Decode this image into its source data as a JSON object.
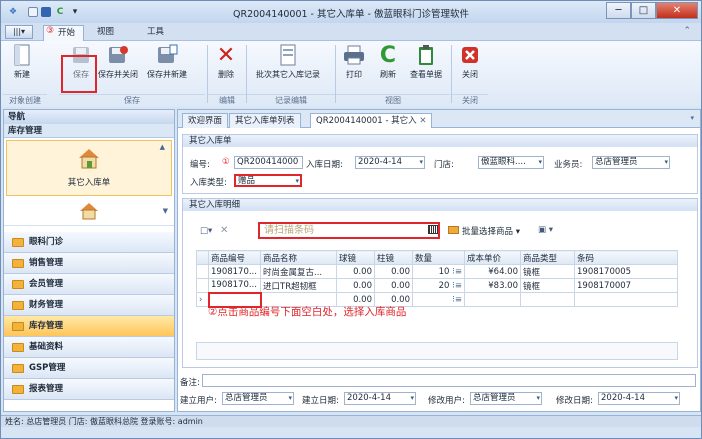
{
  "window": {
    "title": "QR2004140001 - 其它入库单 - 傲蓝眼科门诊管理软件",
    "min": "─",
    "max": "□",
    "close": "✕"
  },
  "quick_access": {
    "dropdown": "▾"
  },
  "ribbon_tabs": {
    "file": "|||▾",
    "start": "开始",
    "view": "视图",
    "tools": "工具",
    "collapse": "⌃"
  },
  "annotations": {
    "n1": "①",
    "n3": "③",
    "hint": "②点击商品编号下面空白处，选择入库商品"
  },
  "toolbar": {
    "new": "新建",
    "save": "保存",
    "save_close": "保存并关闭",
    "save_new": "保存并新建",
    "delete": "删除",
    "batch": "批次其它入库记录",
    "print": "打印",
    "refresh": "刷新",
    "view_doc": "查看单据",
    "close": "关闭"
  },
  "groups": {
    "create": "对象创建",
    "save": "保存",
    "edit": "编辑",
    "record_edit": "记录编辑",
    "view": "视图",
    "close": "关闭"
  },
  "nav": {
    "title": "导航",
    "sub": "库存管理",
    "big_item": "其它入库单",
    "items": [
      "眼科门诊",
      "销售管理",
      "会员管理",
      "财务管理",
      "库存管理",
      "基础资料",
      "GSP管理",
      "报表管理"
    ]
  },
  "doc_tabs": [
    "欢迎界面",
    "其它入库单列表",
    "QR2004140001 - 其它入"
  ],
  "doc_tab_close": "✕",
  "form": {
    "section": "其它入库单",
    "code_label": "编号:",
    "code_value": "QR200414000",
    "date_label": "入库日期:",
    "date_value": "2020-4-14",
    "store_label": "门店:",
    "store_value": "傲蓝眼科....",
    "clerk_label": "业务员:",
    "clerk_value": "总店管理员",
    "type_label": "入库类型:",
    "type_value": "赠品"
  },
  "detail": {
    "section": "其它入库明细",
    "scan_placeholder": "请扫描条码",
    "batch_select": "批量选择商品",
    "add": "□▾",
    "remove": "✕"
  },
  "table": {
    "headers": [
      "商品编号",
      "商品名称",
      "球镜",
      "柱镜",
      "数量",
      "成本单价",
      "商品类型",
      "条码"
    ],
    "rows": [
      [
        "1908170...",
        "时尚金属复古...",
        "0.00",
        "0.00",
        "10",
        "¥64.00",
        "镜框",
        "1908170005"
      ],
      [
        "1908170...",
        "进口TR超韧框",
        "0.00",
        "0.00",
        "20",
        "¥83.00",
        "镜框",
        "1908170007"
      ],
      [
        "",
        "",
        "0.00",
        "0.00",
        "",
        "",
        "",
        ""
      ]
    ]
  },
  "footer": {
    "remark_label": "备注:",
    "creator_label": "建立用户:",
    "creator_value": "总店管理员",
    "create_date_label": "建立日期:",
    "create_date_value": "2020-4-14",
    "modifier_label": "修改用户:",
    "modifier_value": "总店管理员",
    "modify_date_label": "修改日期:",
    "modify_date_value": "2020-4-14"
  },
  "status": "姓名: 总店管理员  门店: 傲蓝眼科总院  登录账号: admin",
  "colors": {
    "accent_red": "#e0262a",
    "nav_selected": "#ffc55a"
  }
}
